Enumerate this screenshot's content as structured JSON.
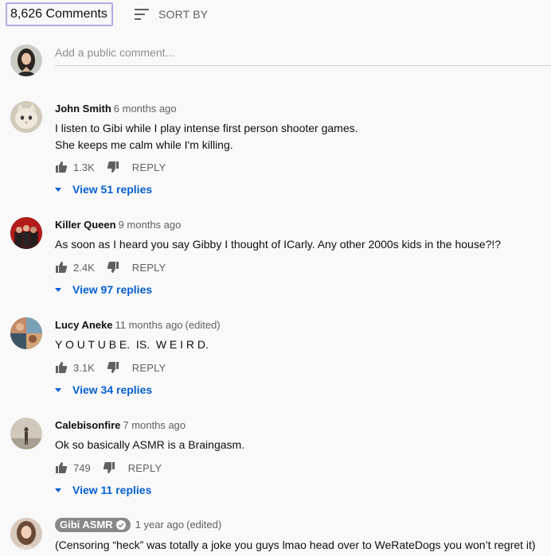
{
  "header": {
    "comment_count": "8,626 Comments",
    "sort_label": "SORT BY"
  },
  "add_comment": {
    "placeholder": "Add a public comment..."
  },
  "comments": [
    {
      "author": "John Smith",
      "time": "6 months ago",
      "edited": "",
      "lines": [
        "I listen to Gibi while I play intense first person shooter games.",
        "She keeps me calm while I'm killing."
      ],
      "likes": "1.3K",
      "reply_label": "REPLY",
      "view_replies": "View 51 replies"
    },
    {
      "author": "Killer Queen",
      "time": "9 months ago",
      "edited": "",
      "lines": [
        "As soon as I heard you say Gibby I thought of ICarly. Any other 2000s kids in the house?!?"
      ],
      "likes": "2.4K",
      "reply_label": "REPLY",
      "view_replies": "View 97 replies"
    },
    {
      "author": "Lucy Aneke",
      "time": "11 months ago",
      "edited": "(edited)",
      "lines": [
        "Y O U T U B E.  IS.  W E I R D."
      ],
      "likes": "3.1K",
      "reply_label": "REPLY",
      "view_replies": "View 34 replies"
    },
    {
      "author": "Calebisonfire",
      "time": "7 months ago",
      "edited": "",
      "lines": [
        "Ok so basically ASMR is a Braingasm."
      ],
      "likes": "749",
      "reply_label": "REPLY",
      "view_replies": "View 11 replies"
    },
    {
      "author": "Gibi ASMR",
      "time": "1 year ago",
      "edited": "(edited)",
      "lines": [
        "(Censoring “heck” was totally a joke you guys lmao head over to WeRateDogs you won’t regret it)"
      ],
      "verified": true
    }
  ],
  "colors": {
    "link_blue": "#065fd4",
    "highlight_border": "#b9a6e8",
    "creator_badge": "#888888"
  },
  "icons": {
    "sort": "sort-icon",
    "like": "thumbs-up-icon",
    "dislike": "thumbs-down-icon",
    "expand": "caret-down-icon",
    "verified": "checkmark-icon"
  }
}
